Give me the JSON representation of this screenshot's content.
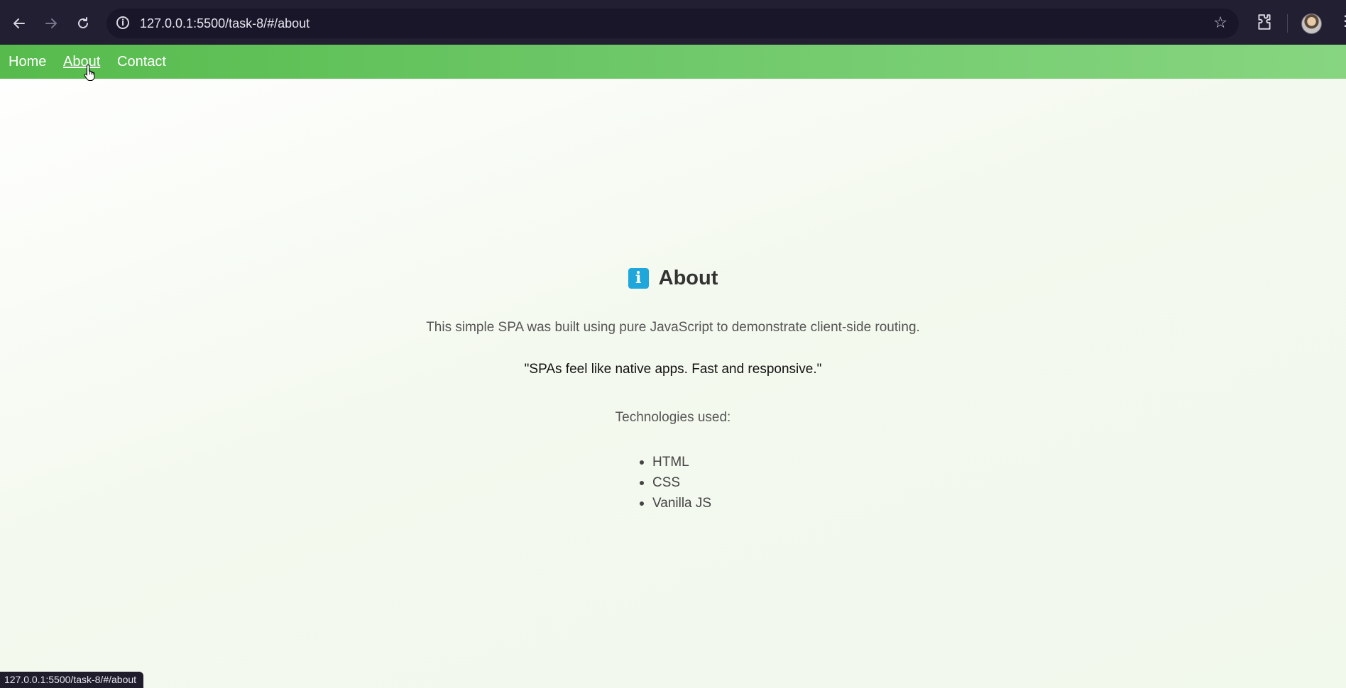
{
  "browser": {
    "url": "127.0.0.1:5500/task-8/#/about",
    "status_url": "127.0.0.1:5500/task-8/#/about"
  },
  "nav": {
    "items": [
      {
        "label": "Home"
      },
      {
        "label": "About"
      },
      {
        "label": "Contact"
      }
    ],
    "active": "About"
  },
  "about": {
    "icon": "info-icon",
    "icon_glyph": "i",
    "title": "About",
    "description": "This simple SPA was built using pure JavaScript to demonstrate client-side routing.",
    "quote": "\"SPAs feel like native apps. Fast and responsive.\"",
    "technologies_label": "Technologies used:",
    "technologies": [
      "HTML",
      "CSS",
      "Vanilla JS"
    ]
  },
  "colors": {
    "nav_start": "#56bb4c",
    "nav_end": "#87d580",
    "info_badge": "#1fa6db",
    "chrome_bg": "#231f33"
  }
}
